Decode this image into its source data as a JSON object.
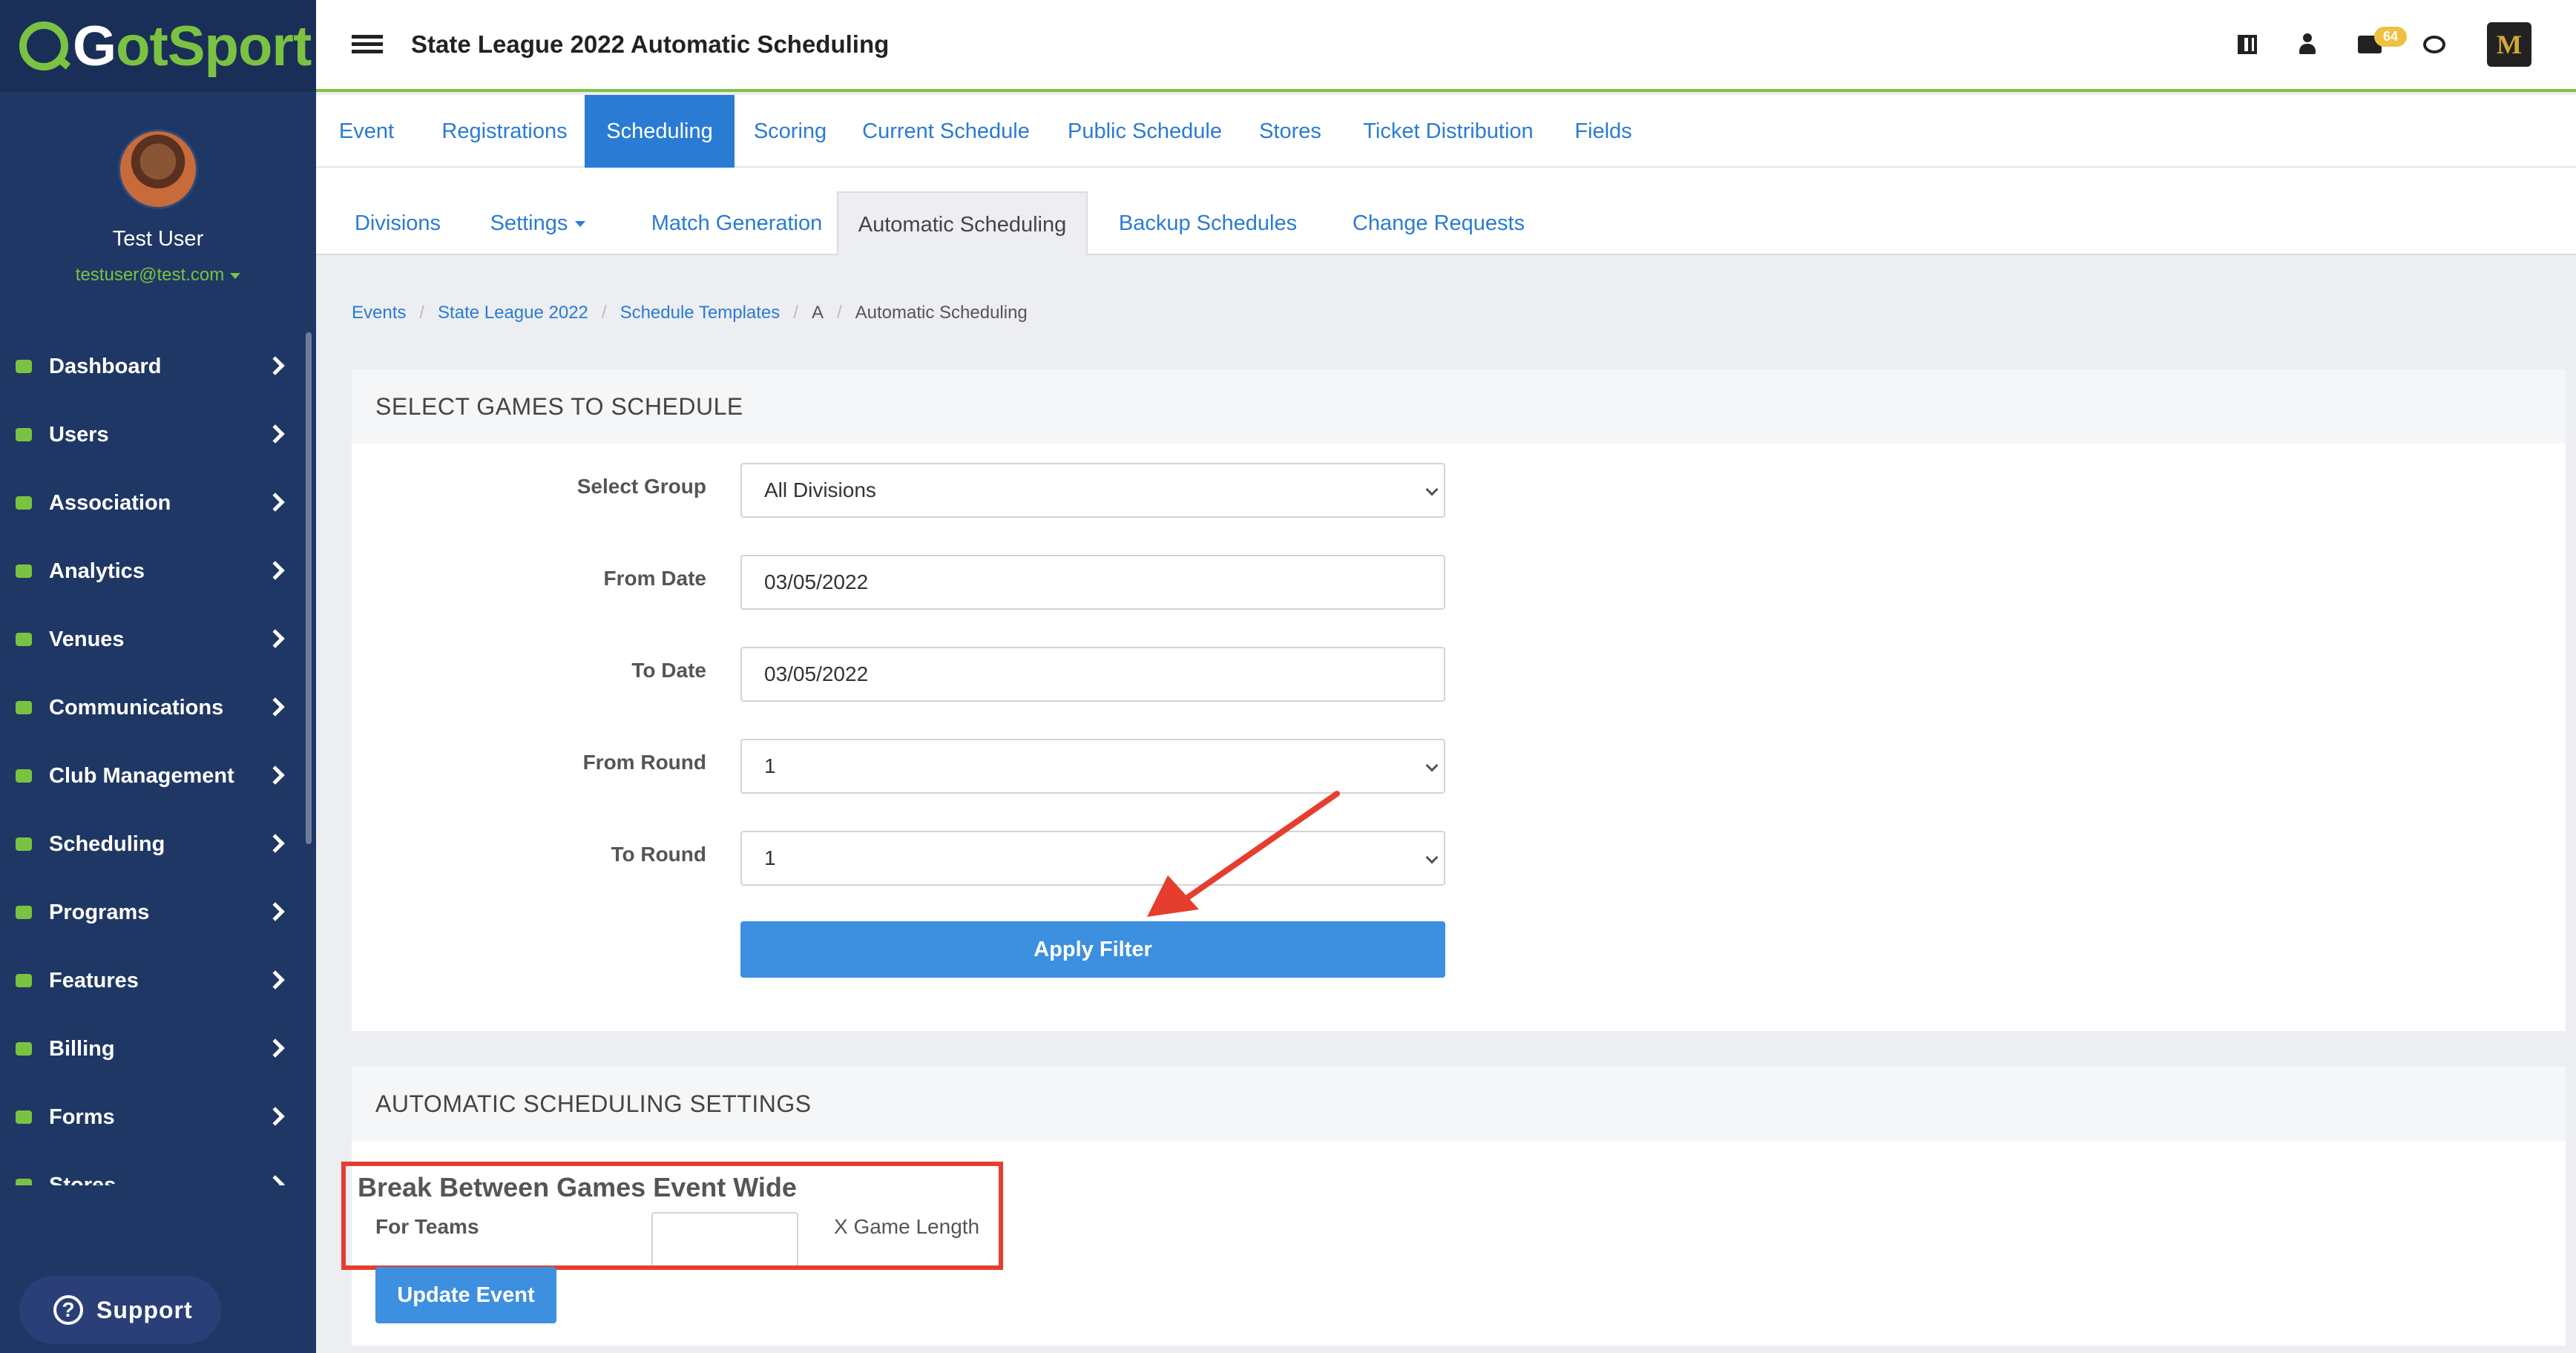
{
  "brand": {
    "logo_part1": "G",
    "logo_part2": "otSport",
    "accent": "#7cc242"
  },
  "header": {
    "title": "State League 2022 Automatic Scheduling",
    "mail_badge": "64",
    "org_logo_letter": "M"
  },
  "profile": {
    "name": "Test User",
    "email": "testuser@test.com"
  },
  "sidebar": {
    "items": [
      {
        "label": "Dashboard",
        "icon": "dashboard-icon"
      },
      {
        "label": "Users",
        "icon": "users-icon"
      },
      {
        "label": "Association",
        "icon": "association-icon"
      },
      {
        "label": "Analytics",
        "icon": "analytics-icon"
      },
      {
        "label": "Venues",
        "icon": "venues-icon"
      },
      {
        "label": "Communications",
        "icon": "communications-icon"
      },
      {
        "label": "Club Management",
        "icon": "club-management-icon"
      },
      {
        "label": "Scheduling",
        "icon": "scheduling-icon"
      },
      {
        "label": "Programs",
        "icon": "programs-icon"
      },
      {
        "label": "Features",
        "icon": "features-icon"
      },
      {
        "label": "Billing",
        "icon": "billing-icon"
      },
      {
        "label": "Forms",
        "icon": "forms-icon"
      },
      {
        "label": "Stores",
        "icon": "stores-icon"
      }
    ],
    "support_label": "Support"
  },
  "main_tabs": [
    "Event",
    "Registrations",
    "Scheduling",
    "Scoring",
    "Current Schedule",
    "Public Schedule",
    "Stores",
    "Ticket Distribution",
    "Fields"
  ],
  "sub_tabs": [
    "Divisions",
    "Settings",
    "Match Generation",
    "Automatic Scheduling",
    "Backup Schedules",
    "Change Requests"
  ],
  "breadcrumb": [
    "Events",
    "State League 2022",
    "Schedule Templates",
    "A",
    "Automatic Scheduling"
  ],
  "select_games": {
    "heading": "SELECT GAMES TO SCHEDULE",
    "group_label": "Select Group",
    "group_value": "All Divisions",
    "from_date_label": "From Date",
    "from_date_value": "03/05/2022",
    "to_date_label": "To Date",
    "to_date_value": "03/05/2022",
    "from_round_label": "From Round",
    "from_round_value": "1",
    "to_round_label": "To Round",
    "to_round_value": "1",
    "apply_label": "Apply Filter"
  },
  "auto_settings": {
    "heading": "AUTOMATIC SCHEDULING SETTINGS",
    "break_title": "Break Between Games Event Wide",
    "for_teams_label": "For Teams",
    "for_teams_value": "",
    "game_length_label": "X Game Length",
    "update_label": "Update Event"
  }
}
